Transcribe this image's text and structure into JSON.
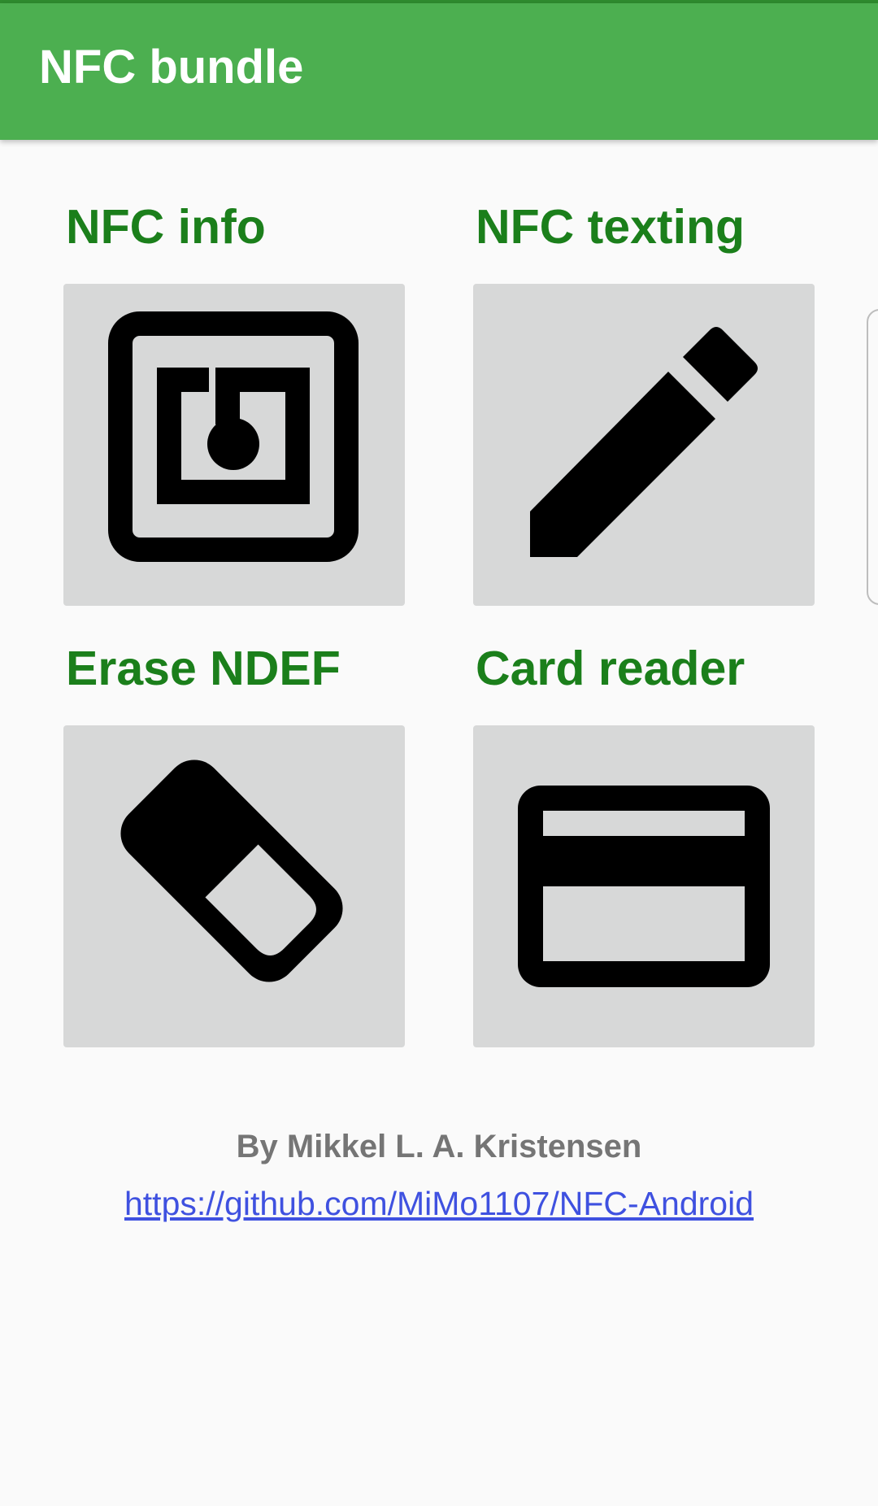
{
  "app_bar": {
    "title": "NFC bundle",
    "color": "#4caf50"
  },
  "tiles": [
    {
      "label": "NFC info",
      "icon": "nfc-icon"
    },
    {
      "label": "NFC texting",
      "icon": "pencil-icon"
    },
    {
      "label": "Erase NDEF",
      "icon": "eraser-icon"
    },
    {
      "label": "Card reader",
      "icon": "credit-card-icon"
    }
  ],
  "footer": {
    "author": "By Mikkel L. A. Kristensen",
    "link": "https://github.com/MiMo1107/NFC-Android"
  },
  "colors": {
    "label_green": "#1b7f1b",
    "tile_bg": "#d7d8d8",
    "link_blue": "#3f51e0"
  }
}
